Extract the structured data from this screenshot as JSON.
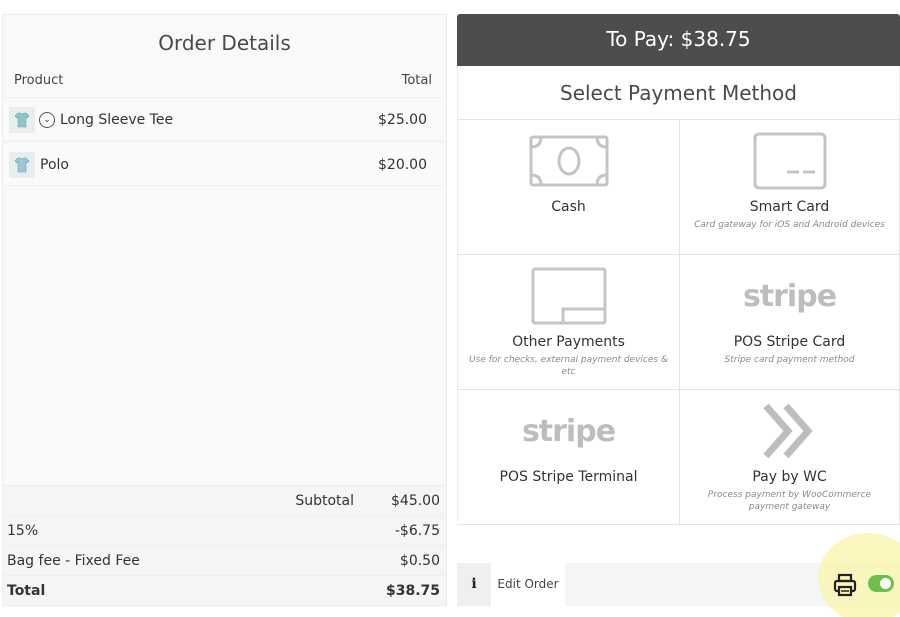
{
  "order": {
    "title": "Order Details",
    "col_product": "Product",
    "col_total": "Total",
    "items": [
      {
        "name": "Long Sleeve Tee",
        "price": "$25.00",
        "icon": "shirt-thumbnail-icon",
        "has_variations": true
      },
      {
        "name": "Polo",
        "price": "$20.00",
        "icon": "shirt-thumbnail-icon",
        "has_variations": false
      }
    ],
    "totals": {
      "subtotal_label": "Subtotal",
      "subtotal_value": "$45.00",
      "discount_label": "15%",
      "discount_value": "-$6.75",
      "fee_label": "Bag fee - Fixed Fee",
      "fee_value": "$0.50",
      "total_label": "Total",
      "total_value": "$38.75"
    }
  },
  "payment": {
    "to_pay": "To Pay: $38.75",
    "select_title": "Select Payment Method",
    "methods": [
      {
        "label": "Cash",
        "sub": "",
        "icon": "cash-icon"
      },
      {
        "label": "Smart Card",
        "sub": "Card gateway for iOS and Android devices",
        "icon": "card-icon"
      },
      {
        "label": "Other Payments",
        "sub": "Use for checks, external payment devices & etc",
        "icon": "other-payment-icon"
      },
      {
        "label": "POS Stripe Card",
        "sub": "Stripe card payment method",
        "icon": "stripe-logo",
        "logo_text": "stripe"
      },
      {
        "label": "POS Stripe Terminal",
        "sub": "",
        "icon": "stripe-logo",
        "logo_text": "stripe"
      },
      {
        "label": "Pay by WC",
        "sub": "Process payment by WooCommerce payment gateway",
        "icon": "double-chevron-right-icon"
      }
    ]
  },
  "bottom": {
    "info_label": "i",
    "edit_order_label": "Edit Order",
    "print_toggle_on": true
  },
  "colors": {
    "header_bg": "#4d4d4d",
    "toggle_on": "#6bbf4a",
    "highlight": "#faf5aa"
  }
}
